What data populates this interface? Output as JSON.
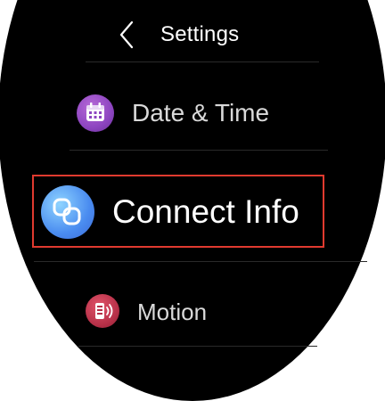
{
  "header": {
    "title": "Settings",
    "back_icon": "chevron-left-icon"
  },
  "menu": {
    "items": [
      {
        "label": "Date & Time",
        "icon": "calendar-icon",
        "color": "#8d45c0"
      },
      {
        "label": "Connect Info",
        "icon": "connect-info-icon",
        "color": "#4a8cf0",
        "highlighted": true,
        "highlight_color": "#e03a2f"
      },
      {
        "label": "Motion",
        "icon": "motion-icon",
        "color": "#b52f47"
      }
    ]
  }
}
